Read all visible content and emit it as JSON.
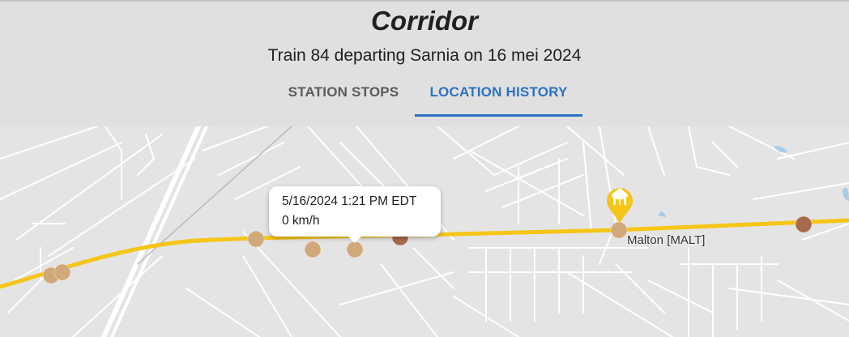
{
  "header": {
    "title": "Corridor",
    "subtitle": "Train 84 departing Sarnia on 16 mei 2024",
    "tabs": [
      {
        "label": "STATION STOPS",
        "active": false
      },
      {
        "label": "LOCATION HISTORY",
        "active": true
      }
    ]
  },
  "map": {
    "route_color": "#f5c518",
    "station": {
      "name": "Malton [MALT]",
      "icon": "station-building-icon",
      "marker_color": "#f5c518"
    },
    "position_marker_colors": [
      "#d1a878",
      "#a86a4c"
    ],
    "tooltip": {
      "timestamp": "5/16/2024 1:21 PM EDT",
      "speed": "0 km/h"
    }
  }
}
